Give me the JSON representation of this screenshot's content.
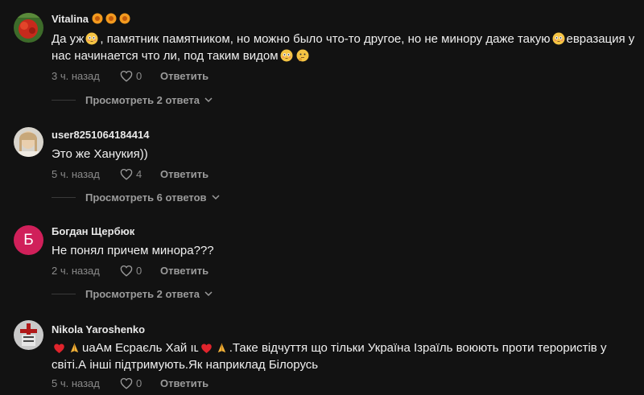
{
  "comments": [
    {
      "author": "Vitalina",
      "author_badges": [
        "sunflower-icon",
        "sunflower-icon",
        "sunflower-icon"
      ],
      "text_parts": [
        "Да уж",
        ", памятник памятником, но можно было что-то другое, но не минору даже такую",
        "евразация у нас начинается что ли, под таким видом"
      ],
      "time": "3 ч. назад",
      "likes": "0",
      "reply_label": "Ответить",
      "view_replies": "Просмотреть 2 ответа"
    },
    {
      "author": "user8251064184414",
      "text": "Это же Ханукия))",
      "time": "5 ч. назад",
      "likes": "4",
      "reply_label": "Ответить",
      "view_replies": "Просмотреть 6 ответов"
    },
    {
      "author": "Богдан Щербюк",
      "avatar_letter": "Б",
      "text": "Не понял причем минора???",
      "time": "2 ч. назад",
      "likes": "0",
      "reply_label": "Ответить",
      "view_replies": "Просмотреть 2 ответа"
    },
    {
      "author": "Nikola Yaroshenko",
      "text_parts": [
        "uaАм Есраєль Хай ıʟ",
        ".Таке відчуття що тільки Україна Ізраїль воюють проти терористів у світі.А інші підтримують.Як наприклад Білорусь"
      ],
      "time": "5 ч. назад",
      "likes": "0",
      "reply_label": "Ответить"
    }
  ],
  "colors": {
    "background": "#121212",
    "avatar_letter_bg": "#d0205a"
  }
}
